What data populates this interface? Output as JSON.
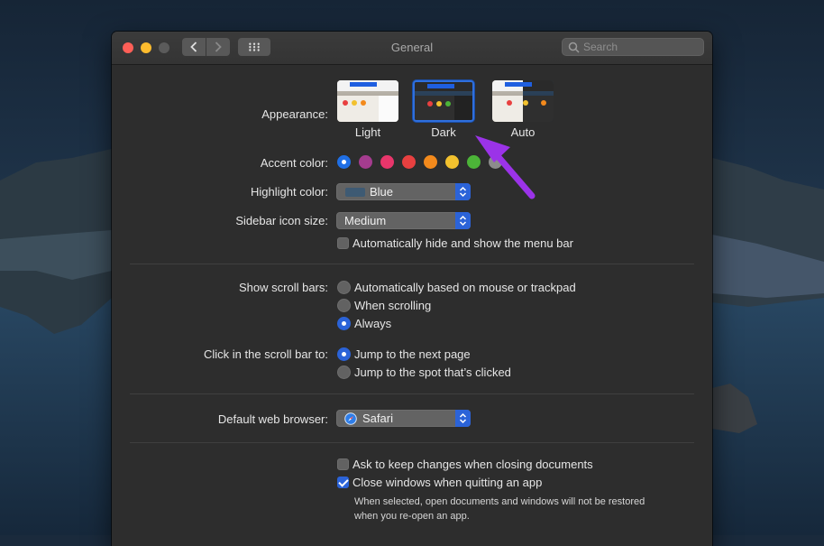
{
  "window": {
    "title": "General",
    "search_placeholder": "Search"
  },
  "appearance": {
    "label": "Appearance:",
    "options": [
      {
        "name": "Light",
        "selected": false
      },
      {
        "name": "Dark",
        "selected": true
      },
      {
        "name": "Auto",
        "selected": false
      }
    ]
  },
  "accent": {
    "label": "Accent color:",
    "colors": [
      "#1f6fe5",
      "#a53c8f",
      "#e8366b",
      "#e84040",
      "#f38a1c",
      "#f2c12e",
      "#4cb438",
      "#8c8c8c"
    ],
    "selected_index": 0
  },
  "highlight": {
    "label": "Highlight color:",
    "value": "Blue"
  },
  "sidebar_size": {
    "label": "Sidebar icon size:",
    "value": "Medium"
  },
  "menubar_check": {
    "label": "Automatically hide and show the menu bar",
    "checked": false
  },
  "scrollbars": {
    "label": "Show scroll bars:",
    "options": [
      {
        "label": "Automatically based on mouse or trackpad",
        "selected": false
      },
      {
        "label": "When scrolling",
        "selected": false
      },
      {
        "label": "Always",
        "selected": true
      }
    ]
  },
  "click_scroll": {
    "label": "Click in the scroll bar to:",
    "options": [
      {
        "label": "Jump to the next page",
        "selected": true
      },
      {
        "label": "Jump to the spot that’s clicked",
        "selected": false
      }
    ]
  },
  "browser": {
    "label": "Default web browser:",
    "value": "Safari"
  },
  "ask_changes": {
    "label": "Ask to keep changes when closing documents",
    "checked": false
  },
  "close_windows": {
    "label": "Close windows when quitting an app",
    "checked": true
  },
  "close_hint": {
    "line1": "When selected, open documents and windows will not be restored",
    "line2": "when you re-open an app."
  },
  "colors": {
    "accent_blue": "#2b63d8",
    "arrow": "#9b33e8",
    "window_bg": "#2d2d2d"
  }
}
